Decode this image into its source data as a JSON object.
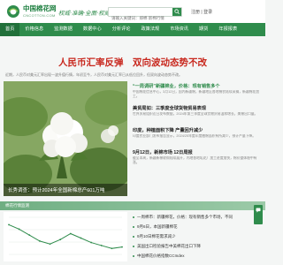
{
  "header": {
    "logo_cn": "中国棉花网",
    "logo_en": "CNCOTTON.COM",
    "slogan": "权威·准确·全面·权威",
    "search_placeholder": "请输入关键词：郑棉 新棉行情",
    "login": "注册 | 登录"
  },
  "nav": {
    "items": [
      "首页",
      "价格信息",
      "监测数据",
      "数据中心",
      "分析评论",
      "政策法规",
      "市场资讯",
      "期货",
      "年报报表",
      "报告"
    ]
  },
  "headline": "人民币汇率反弹　双向波动态势不改",
  "summary": "近期，人民币对美元汇率出现一波升值行情，年初至今，人民币对美元汇率已从低位回升，但双向波动态势不改。",
  "hero": {
    "caption": "长秀调查：预计2024年全国新棉总产601万吨",
    "dot_count": 5,
    "active_dot": 1
  },
  "news": [
    {
      "title": "“一周调研”新疆棉业，价格：现有销售多个",
      "desc": "中国棉花信息中心，3月12日，国内新疆棉，新疆地区各地棉农陆续采摘，新疆棉花加工。",
      "hot": true
    },
    {
      "title": "美贸局如：三季度全球货物贸易表现",
      "desc": "世界贸易组织近日发布数据，2024年第三季度全球货物贸易温和增长，美棉出口量。",
      "hot": false
    },
    {
      "title": "印度，种植面积下降 产量回升减少",
      "desc": "印度农业部门发布报告显示，2024/25年度印度植棉面积有所减少，预计产量下降。",
      "hot": false
    },
    {
      "title": "9月12日，新棉市场 12日周报",
      "desc": "截至本周，新疆新棉收购陆续展开，内地各地轧花厂加工进度加快，棉价整体稳中有涨。",
      "hot": false
    }
  ],
  "strip_label": "棉花行情监测",
  "bullets": [
    "一周棉市：新疆棉花，价格：现有销售多个市场，不同",
    "9月6日，本国新疆棉花",
    "9月10日棉花需求减少",
    "美国出口检验报告中美棉花出口下降",
    "中国棉花价格指数CCIndex"
  ],
  "colors": {
    "brand_green": "#2f8c4c",
    "headline_red": "#c8281e"
  },
  "chart_data": {
    "type": "line",
    "title": "",
    "x": [
      "1",
      "2",
      "3",
      "4",
      "5",
      "6",
      "7",
      "8",
      "9",
      "10",
      "11",
      "12"
    ],
    "series": [
      {
        "name": "",
        "values": [
          17500,
          17200,
          16800,
          16400,
          16200,
          16500,
          16900,
          16600,
          16300,
          16100,
          15900,
          16000
        ]
      }
    ],
    "ylim": [
      15500,
      18000
    ],
    "xlabel": "",
    "ylabel": ""
  }
}
